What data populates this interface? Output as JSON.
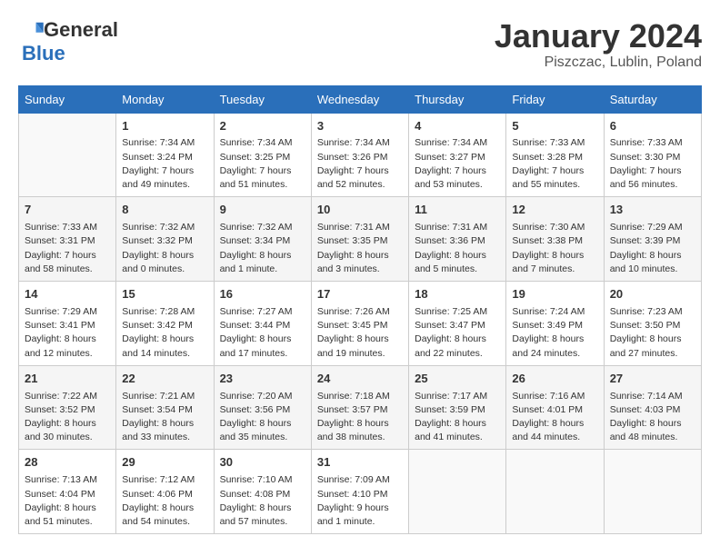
{
  "header": {
    "logo_general": "General",
    "logo_blue": "Blue",
    "month_title": "January 2024",
    "location": "Piszczac, Lublin, Poland"
  },
  "weekdays": [
    "Sunday",
    "Monday",
    "Tuesday",
    "Wednesday",
    "Thursday",
    "Friday",
    "Saturday"
  ],
  "weeks": [
    [
      {
        "day": "",
        "info": ""
      },
      {
        "day": "1",
        "info": "Sunrise: 7:34 AM\nSunset: 3:24 PM\nDaylight: 7 hours\nand 49 minutes."
      },
      {
        "day": "2",
        "info": "Sunrise: 7:34 AM\nSunset: 3:25 PM\nDaylight: 7 hours\nand 51 minutes."
      },
      {
        "day": "3",
        "info": "Sunrise: 7:34 AM\nSunset: 3:26 PM\nDaylight: 7 hours\nand 52 minutes."
      },
      {
        "day": "4",
        "info": "Sunrise: 7:34 AM\nSunset: 3:27 PM\nDaylight: 7 hours\nand 53 minutes."
      },
      {
        "day": "5",
        "info": "Sunrise: 7:33 AM\nSunset: 3:28 PM\nDaylight: 7 hours\nand 55 minutes."
      },
      {
        "day": "6",
        "info": "Sunrise: 7:33 AM\nSunset: 3:30 PM\nDaylight: 7 hours\nand 56 minutes."
      }
    ],
    [
      {
        "day": "7",
        "info": "Sunrise: 7:33 AM\nSunset: 3:31 PM\nDaylight: 7 hours\nand 58 minutes."
      },
      {
        "day": "8",
        "info": "Sunrise: 7:32 AM\nSunset: 3:32 PM\nDaylight: 8 hours\nand 0 minutes."
      },
      {
        "day": "9",
        "info": "Sunrise: 7:32 AM\nSunset: 3:34 PM\nDaylight: 8 hours\nand 1 minute."
      },
      {
        "day": "10",
        "info": "Sunrise: 7:31 AM\nSunset: 3:35 PM\nDaylight: 8 hours\nand 3 minutes."
      },
      {
        "day": "11",
        "info": "Sunrise: 7:31 AM\nSunset: 3:36 PM\nDaylight: 8 hours\nand 5 minutes."
      },
      {
        "day": "12",
        "info": "Sunrise: 7:30 AM\nSunset: 3:38 PM\nDaylight: 8 hours\nand 7 minutes."
      },
      {
        "day": "13",
        "info": "Sunrise: 7:29 AM\nSunset: 3:39 PM\nDaylight: 8 hours\nand 10 minutes."
      }
    ],
    [
      {
        "day": "14",
        "info": "Sunrise: 7:29 AM\nSunset: 3:41 PM\nDaylight: 8 hours\nand 12 minutes."
      },
      {
        "day": "15",
        "info": "Sunrise: 7:28 AM\nSunset: 3:42 PM\nDaylight: 8 hours\nand 14 minutes."
      },
      {
        "day": "16",
        "info": "Sunrise: 7:27 AM\nSunset: 3:44 PM\nDaylight: 8 hours\nand 17 minutes."
      },
      {
        "day": "17",
        "info": "Sunrise: 7:26 AM\nSunset: 3:45 PM\nDaylight: 8 hours\nand 19 minutes."
      },
      {
        "day": "18",
        "info": "Sunrise: 7:25 AM\nSunset: 3:47 PM\nDaylight: 8 hours\nand 22 minutes."
      },
      {
        "day": "19",
        "info": "Sunrise: 7:24 AM\nSunset: 3:49 PM\nDaylight: 8 hours\nand 24 minutes."
      },
      {
        "day": "20",
        "info": "Sunrise: 7:23 AM\nSunset: 3:50 PM\nDaylight: 8 hours\nand 27 minutes."
      }
    ],
    [
      {
        "day": "21",
        "info": "Sunrise: 7:22 AM\nSunset: 3:52 PM\nDaylight: 8 hours\nand 30 minutes."
      },
      {
        "day": "22",
        "info": "Sunrise: 7:21 AM\nSunset: 3:54 PM\nDaylight: 8 hours\nand 33 minutes."
      },
      {
        "day": "23",
        "info": "Sunrise: 7:20 AM\nSunset: 3:56 PM\nDaylight: 8 hours\nand 35 minutes."
      },
      {
        "day": "24",
        "info": "Sunrise: 7:18 AM\nSunset: 3:57 PM\nDaylight: 8 hours\nand 38 minutes."
      },
      {
        "day": "25",
        "info": "Sunrise: 7:17 AM\nSunset: 3:59 PM\nDaylight: 8 hours\nand 41 minutes."
      },
      {
        "day": "26",
        "info": "Sunrise: 7:16 AM\nSunset: 4:01 PM\nDaylight: 8 hours\nand 44 minutes."
      },
      {
        "day": "27",
        "info": "Sunrise: 7:14 AM\nSunset: 4:03 PM\nDaylight: 8 hours\nand 48 minutes."
      }
    ],
    [
      {
        "day": "28",
        "info": "Sunrise: 7:13 AM\nSunset: 4:04 PM\nDaylight: 8 hours\nand 51 minutes."
      },
      {
        "day": "29",
        "info": "Sunrise: 7:12 AM\nSunset: 4:06 PM\nDaylight: 8 hours\nand 54 minutes."
      },
      {
        "day": "30",
        "info": "Sunrise: 7:10 AM\nSunset: 4:08 PM\nDaylight: 8 hours\nand 57 minutes."
      },
      {
        "day": "31",
        "info": "Sunrise: 7:09 AM\nSunset: 4:10 PM\nDaylight: 9 hours\nand 1 minute."
      },
      {
        "day": "",
        "info": ""
      },
      {
        "day": "",
        "info": ""
      },
      {
        "day": "",
        "info": ""
      }
    ]
  ]
}
